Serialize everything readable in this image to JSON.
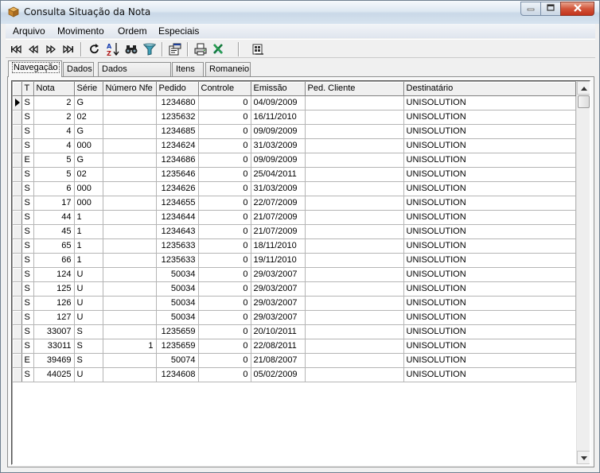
{
  "window": {
    "title": "Consulta Situação da Nota",
    "icon": "box-app-icon",
    "caption_buttons": [
      "minimize-icon",
      "maximize-icon",
      "close-icon"
    ]
  },
  "menu": [
    "Arquivo",
    "Movimento",
    "Ordem",
    "Especiais"
  ],
  "toolbar": {
    "buttons": [
      "first-record-icon",
      "prior-record-icon",
      "next-record-icon",
      "last-record-icon",
      "refresh-icon",
      "sort-az-icon",
      "binoculars-find-icon",
      "filter-funnel-icon",
      "properties-icon",
      "print-icon",
      "excel-export-icon",
      "report-icon"
    ]
  },
  "tabs": [
    "Navegação",
    "Dados",
    "Dados Adicionais",
    "Itens",
    "Romaneio"
  ],
  "active_tab": "Navegação",
  "grid": {
    "columns": [
      "T",
      "Nota",
      "Série",
      "Número Nfe",
      "Pedido",
      "Controle",
      "Emissão",
      "Ped. Cliente",
      "Destinatário"
    ],
    "current_row": 0,
    "rows": [
      [
        "S",
        "2",
        "G",
        "",
        "1234680",
        "0",
        "04/09/2009",
        "",
        "UNISOLUTION"
      ],
      [
        "S",
        "2",
        "02",
        "",
        "1235632",
        "0",
        "16/11/2010",
        "",
        "UNISOLUTION"
      ],
      [
        "S",
        "4",
        "G",
        "",
        "1234685",
        "0",
        "09/09/2009",
        "",
        "UNISOLUTION"
      ],
      [
        "S",
        "4",
        "000",
        "",
        "1234624",
        "0",
        "31/03/2009",
        "",
        "UNISOLUTION"
      ],
      [
        "E",
        "5",
        "G",
        "",
        "1234686",
        "0",
        "09/09/2009",
        "",
        "UNISOLUTION"
      ],
      [
        "S",
        "5",
        "02",
        "",
        "1235646",
        "0",
        "25/04/2011",
        "",
        "UNISOLUTION"
      ],
      [
        "S",
        "6",
        "000",
        "",
        "1234626",
        "0",
        "31/03/2009",
        "",
        "UNISOLUTION"
      ],
      [
        "S",
        "17",
        "000",
        "",
        "1234655",
        "0",
        "22/07/2009",
        "",
        "UNISOLUTION"
      ],
      [
        "S",
        "44",
        "1",
        "",
        "1234644",
        "0",
        "21/07/2009",
        "",
        "UNISOLUTION"
      ],
      [
        "S",
        "45",
        "1",
        "",
        "1234643",
        "0",
        "21/07/2009",
        "",
        "UNISOLUTION"
      ],
      [
        "S",
        "65",
        "1",
        "",
        "1235633",
        "0",
        "18/11/2010",
        "",
        "UNISOLUTION"
      ],
      [
        "S",
        "66",
        "1",
        "",
        "1235633",
        "0",
        "19/11/2010",
        "",
        "UNISOLUTION"
      ],
      [
        "S",
        "124",
        "U",
        "",
        "50034",
        "0",
        "29/03/2007",
        "",
        "UNISOLUTION"
      ],
      [
        "S",
        "125",
        "U",
        "",
        "50034",
        "0",
        "29/03/2007",
        "",
        "UNISOLUTION"
      ],
      [
        "S",
        "126",
        "U",
        "",
        "50034",
        "0",
        "29/03/2007",
        "",
        "UNISOLUTION"
      ],
      [
        "S",
        "127",
        "U",
        "",
        "50034",
        "0",
        "29/03/2007",
        "",
        "UNISOLUTION"
      ],
      [
        "S",
        "33007",
        "S",
        "",
        "1235659",
        "0",
        "20/10/2011",
        "",
        "UNISOLUTION"
      ],
      [
        "S",
        "33011",
        "S",
        "1",
        "1235659",
        "0",
        "22/08/2011",
        "",
        "UNISOLUTION"
      ],
      [
        "E",
        "39469",
        "S",
        "",
        "50074",
        "0",
        "21/08/2007",
        "",
        "UNISOLUTION"
      ],
      [
        "S",
        "44025",
        "U",
        "",
        "1234608",
        "0",
        "05/02/2009",
        "",
        "UNISOLUTION"
      ]
    ]
  },
  "colors": {
    "titlebar": "#dde8f2",
    "close_button": "#c2331c",
    "face": "#f0f0f0"
  }
}
